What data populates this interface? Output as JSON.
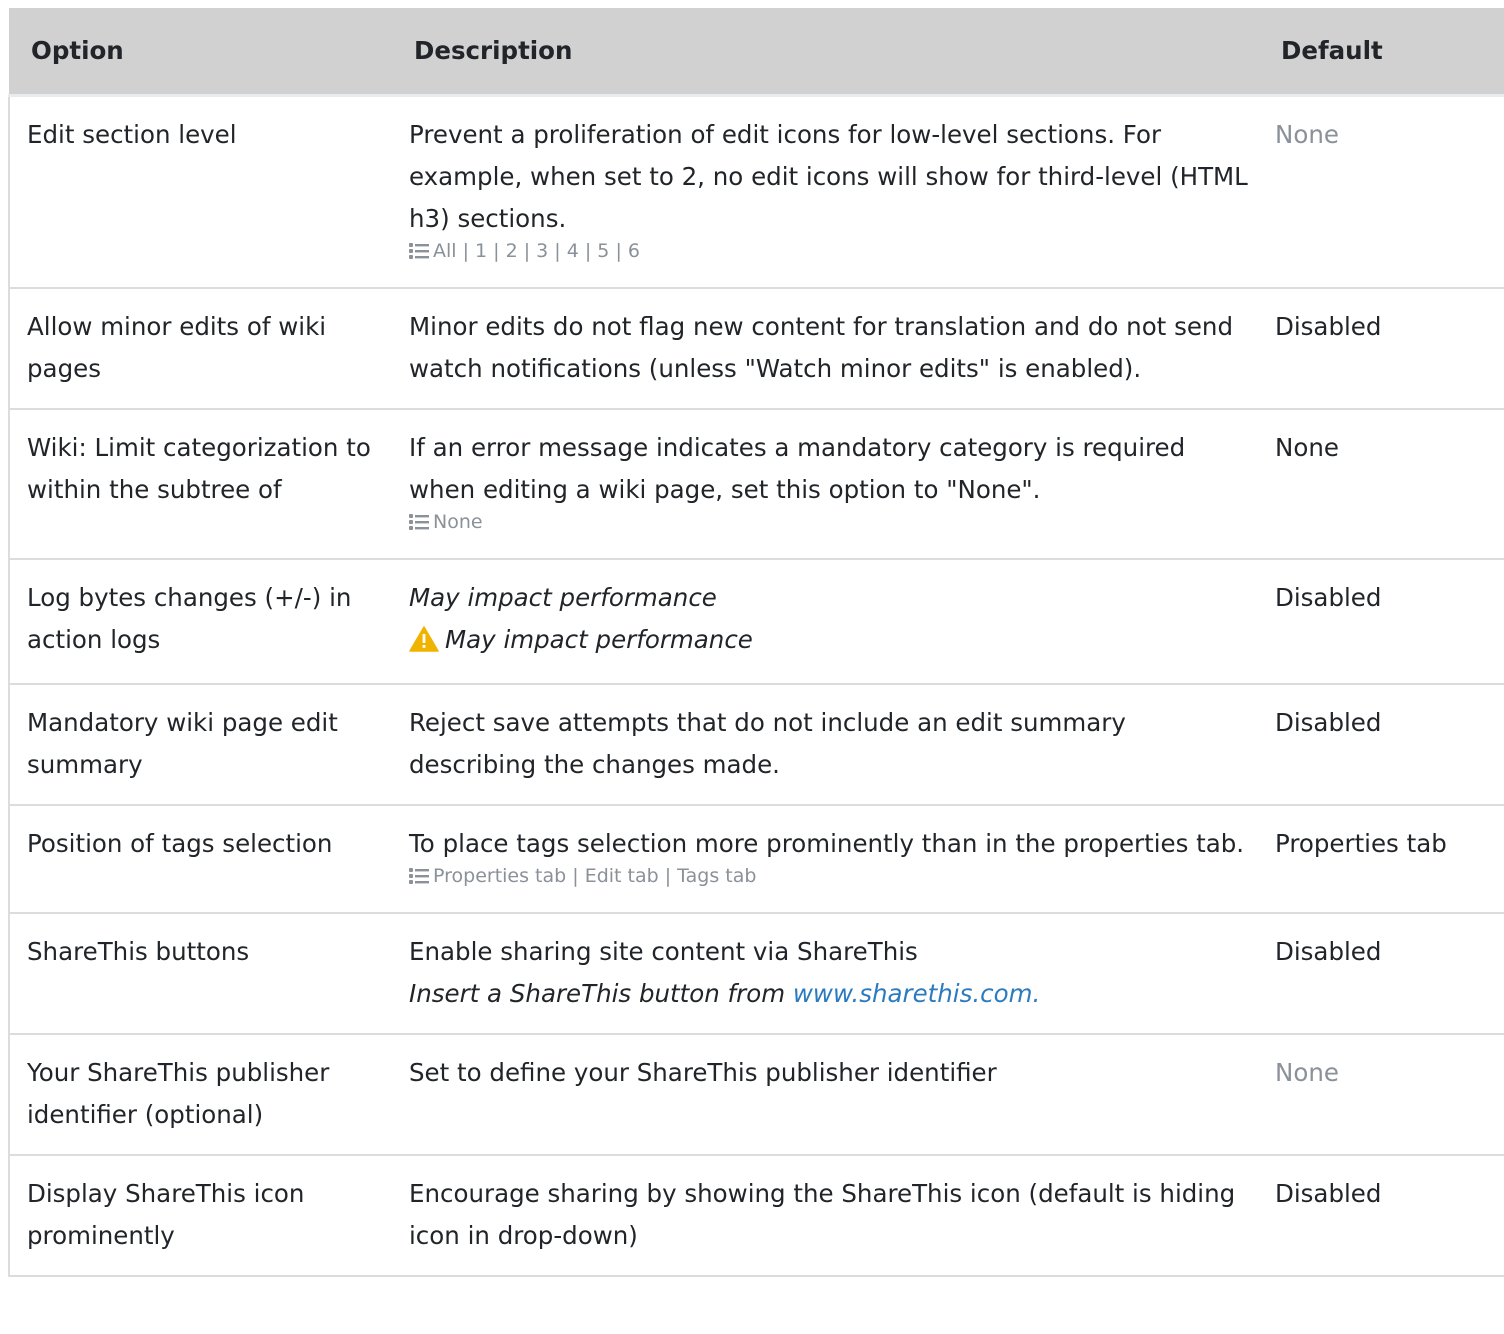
{
  "headers": {
    "option": "Option",
    "description": "Description",
    "default": "Default"
  },
  "rows": [
    {
      "option": "Edit section level",
      "description": "Prevent a proliferation of edit icons for low-level sections. For example, when set to 2, no edit icons will show for third-level (HTML h3) sections.",
      "choices": "All | 1 | 2 | 3 | 4 | 5 | 6",
      "default": "None"
    },
    {
      "option": "Allow minor edits of wiki pages",
      "description": "Minor edits do not flag new content for translation and do not send watch notifications (unless \"Watch minor edits\" is enabled).",
      "default": "Disabled"
    },
    {
      "option": "Wiki: Limit categorization to within the subtree of",
      "description": "If an error message indicates a mandatory category is required when editing a wiki page, set this option to \"None\".",
      "choices": "None",
      "default": "None"
    },
    {
      "option": "Log bytes changes (+/-) in action logs",
      "description": "May impact performance",
      "warning": "May impact performance",
      "default": "Disabled"
    },
    {
      "option": "Mandatory wiki page edit summary",
      "description": "Reject save attempts that do not include an edit summary describing the changes made.",
      "default": "Disabled"
    },
    {
      "option": "Position of tags selection",
      "description": "To place tags selection more prominently than in the properties tab.",
      "choices": "Properties tab | Edit tab | Tags tab",
      "default": "Properties tab"
    },
    {
      "option": "ShareThis buttons",
      "description": "Enable sharing site content via ShareThis",
      "note": "Insert a ShareThis button from ",
      "link": "www.sharethis.com.",
      "default": "Disabled"
    },
    {
      "option": "Your ShareThis publisher identifier (optional)",
      "description": "Set to define your ShareThis publisher identifier",
      "default": "None"
    },
    {
      "option": "Display ShareThis icon prominently",
      "description": "Encourage sharing by showing the ShareThis icon (default is hiding icon in drop-down)",
      "default": "Disabled"
    }
  ],
  "colors": {
    "header_bg": "#d1d1d1",
    "muted_text": "#8a9199",
    "link": "#2c7bbf",
    "warning": "#f0b400"
  },
  "icons": {
    "list": "list-icon",
    "warning": "warning-icon"
  }
}
